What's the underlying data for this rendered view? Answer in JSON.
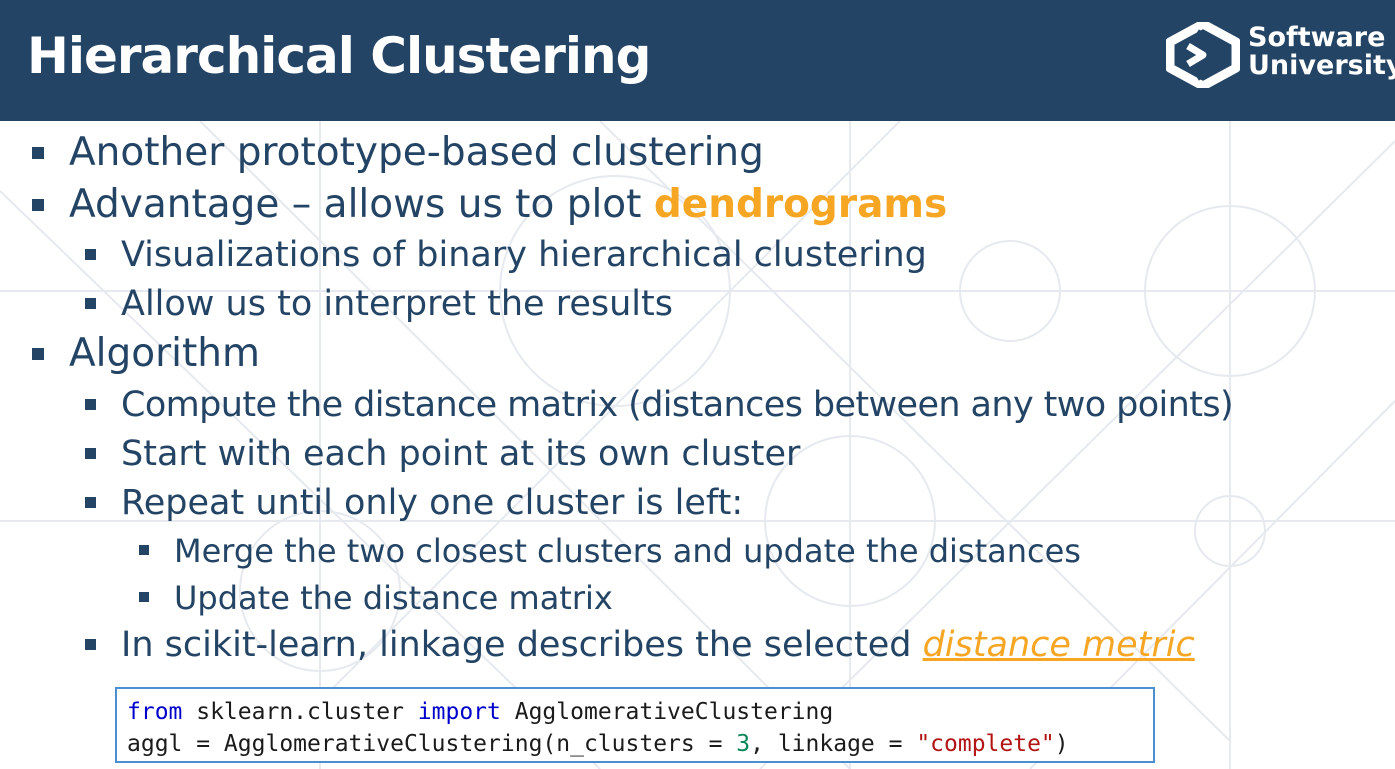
{
  "header": {
    "title": "Hierarchical Clustering",
    "logo_line1": "Software",
    "logo_line2": "University"
  },
  "bullets": [
    {
      "text": "Another prototype-based clustering",
      "level": 1
    },
    {
      "prefix": "Advantage – allows us to plot ",
      "highlight": "dendrograms",
      "level": 1
    },
    {
      "text": "Visualizations of binary hierarchical clustering",
      "level": 2
    },
    {
      "text": "Allow us to interpret the results",
      "level": 2
    },
    {
      "text": "Algorithm",
      "level": 1
    },
    {
      "text": "Compute the distance matrix (distances between any two points)",
      "level": 2
    },
    {
      "text": "Start with each point at its own cluster",
      "level": 2
    },
    {
      "text": "Repeat until only one cluster is left:",
      "level": 2
    },
    {
      "text": "Merge the two closest clusters and update the distances",
      "level": 3
    },
    {
      "text": "Update the distance matrix",
      "level": 3
    },
    {
      "prefix": "In scikit-learn, linkage describes the selected ",
      "link": "distance metric",
      "level": 2
    }
  ],
  "code": {
    "line1_kw1": "from",
    "line1_mod": " sklearn.cluster ",
    "line1_kw2": "import",
    "line1_cls": " AgglomerativeClustering",
    "line2_pre": "aggl = AgglomerativeClustering(n_clusters = ",
    "line2_num": "3",
    "line2_mid": ", linkage = ",
    "line2_str": "\"complete\"",
    "line2_end": ")"
  },
  "colors": {
    "header_bg": "#234465",
    "text": "#234465",
    "accent": "#f6a623",
    "code_border": "#4a90d0"
  }
}
